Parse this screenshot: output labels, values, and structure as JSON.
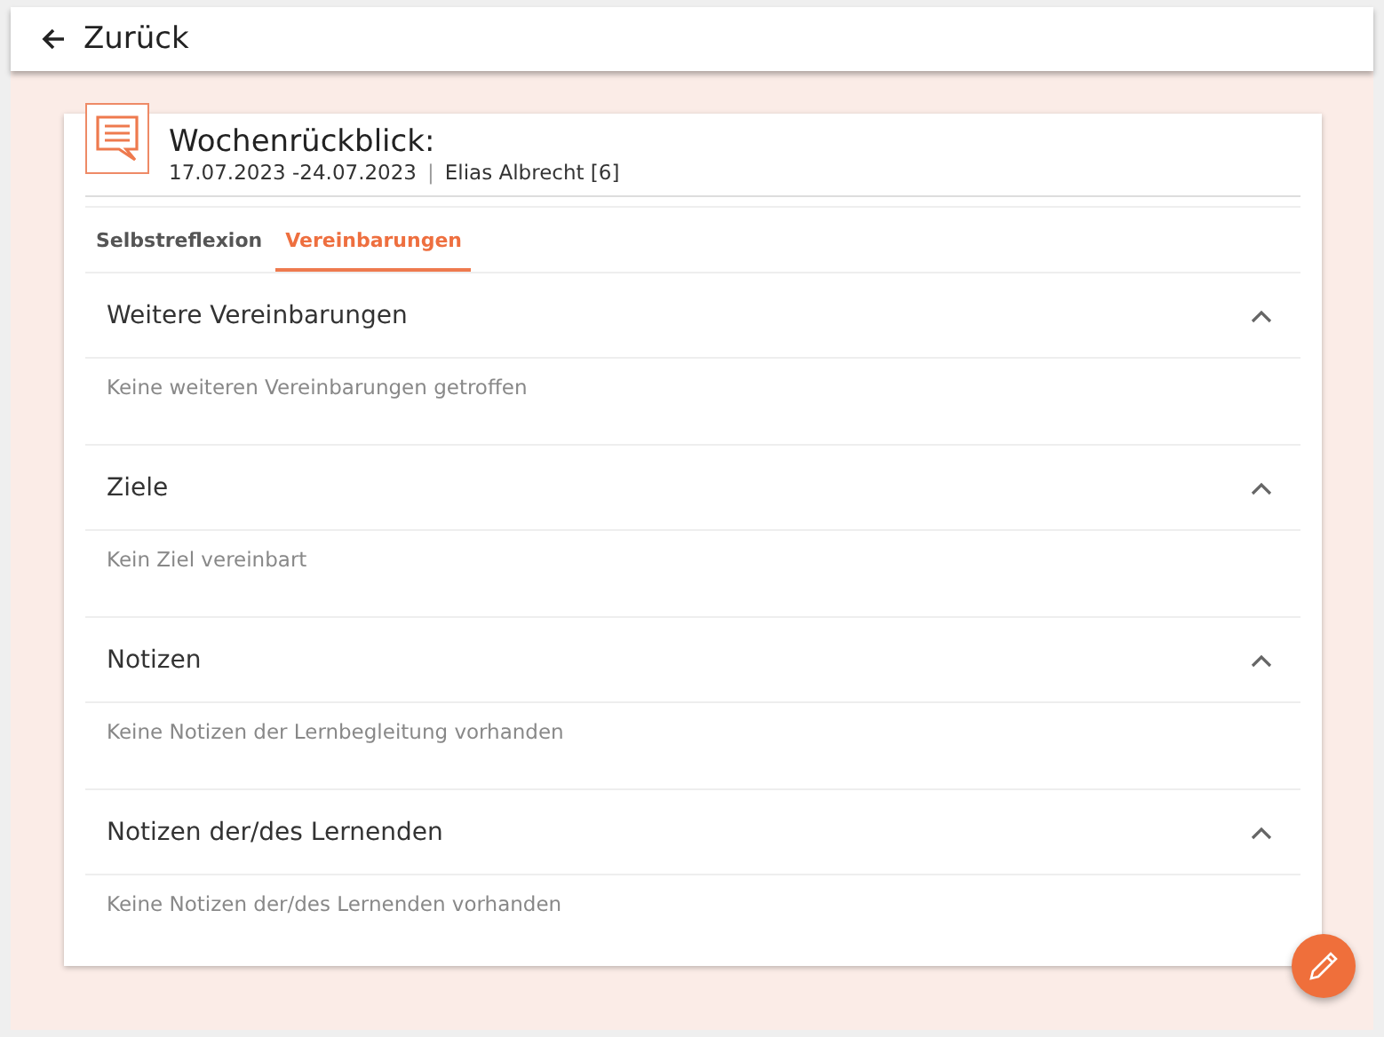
{
  "back_button": {
    "label": "Zurück"
  },
  "review": {
    "title": "Wochenrückblick:",
    "date_range": "17.07.2023 -24.07.2023",
    "separator": "|",
    "learner": "Elias Albrecht [6]"
  },
  "tabs": [
    {
      "label": "Selbstreflexion",
      "selected": false
    },
    {
      "label": "Vereinbarungen",
      "selected": true
    }
  ],
  "sections": [
    {
      "title": "Weitere Vereinbarungen",
      "expanded": true,
      "content": "Keine weiteren Vereinbarungen getroffen"
    },
    {
      "title": "Ziele",
      "expanded": true,
      "content": "Kein Ziel vereinbart"
    },
    {
      "title": "Notizen",
      "expanded": true,
      "content": "Keine Notizen der Lernbegleitung vorhanden"
    },
    {
      "title": "Notizen der/des Lernenden",
      "expanded": true,
      "content": "Keine Notizen der/des Lernenden vorhanden"
    }
  ]
}
